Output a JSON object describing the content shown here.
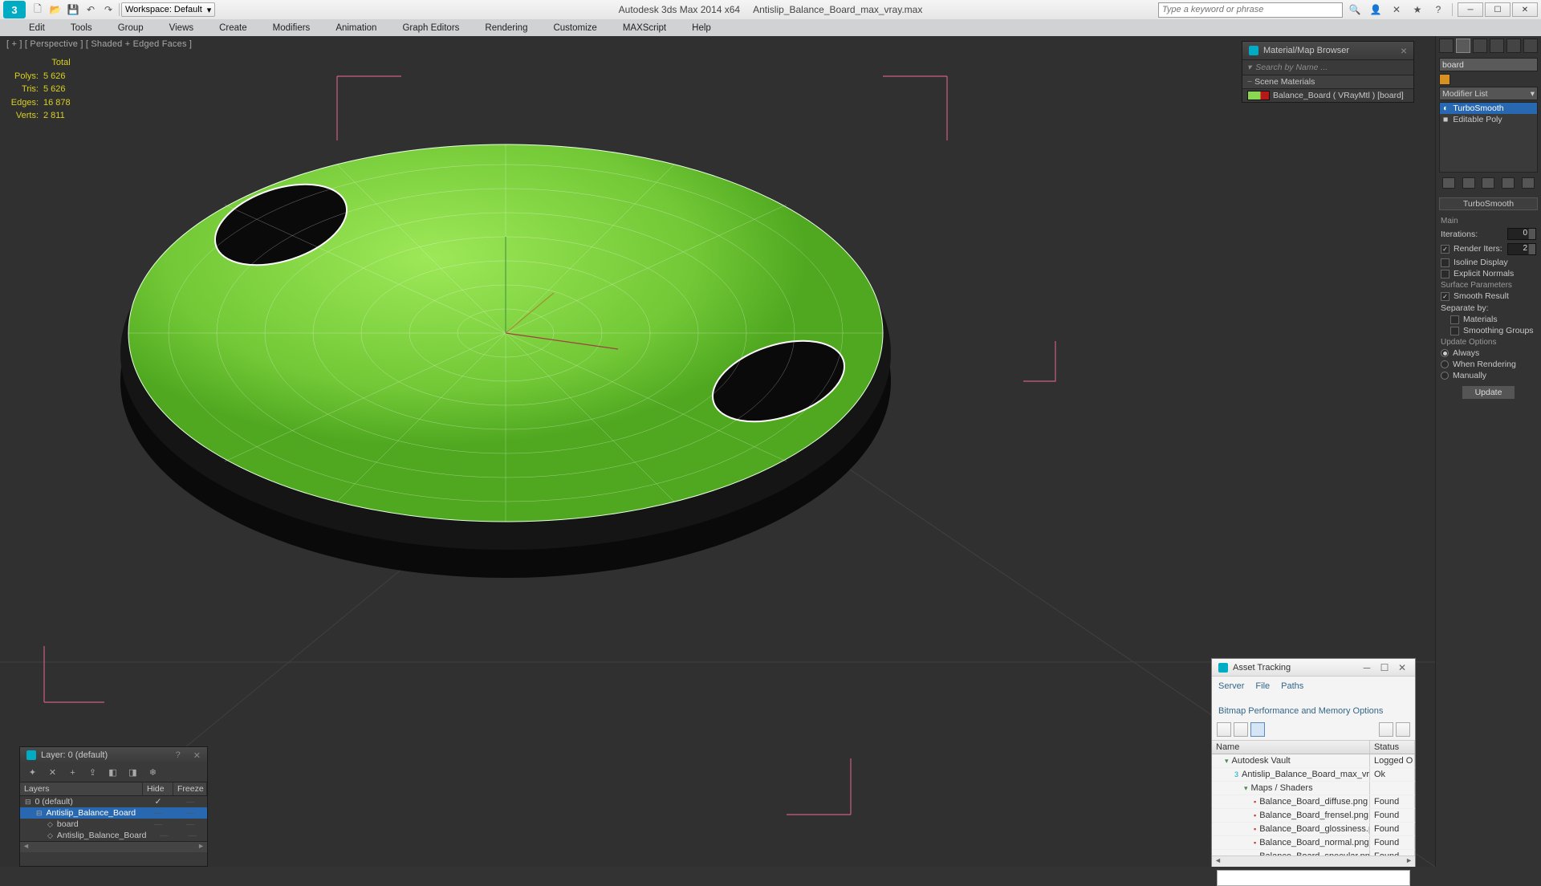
{
  "title": {
    "app": "Autodesk 3ds Max  2014 x64",
    "file": "Antislip_Balance_Board_max_vray.max"
  },
  "toolbar": {
    "workspace_label": "Workspace: Default",
    "search_placeholder": "Type a keyword or phrase"
  },
  "menus": [
    "Edit",
    "Tools",
    "Group",
    "Views",
    "Create",
    "Modifiers",
    "Animation",
    "Graph Editors",
    "Rendering",
    "Customize",
    "MAXScript",
    "Help"
  ],
  "viewport": {
    "label": "[ + ] [ Perspective ] [ Shaded + Edged Faces ]"
  },
  "stats": {
    "polys_label": "Polys:",
    "polys": "5 626",
    "tris_label": "Tris:",
    "tris": "5 626",
    "edges_label": "Edges:",
    "edges": "16 878",
    "verts_label": "Verts:",
    "verts": "2 811",
    "total": "Total"
  },
  "right_panel": {
    "object_name": "board",
    "modifier_list_label": "Modifier List",
    "stack": [
      {
        "icon": "◐",
        "name": "TurboSmooth"
      },
      {
        "icon": "■",
        "name": "Editable Poly"
      }
    ],
    "rollout": "TurboSmooth",
    "main_label": "Main",
    "iterations_label": "Iterations:",
    "iterations_val": "0",
    "render_iters_label": "Render Iters:",
    "render_iters_val": "2",
    "isoline_label": "Isoline Display",
    "explicit_label": "Explicit Normals",
    "surface_params_label": "Surface Parameters",
    "smooth_result_label": "Smooth Result",
    "separate_label": "Separate by:",
    "materials_label": "Materials",
    "smoothing_groups_label": "Smoothing Groups",
    "update_options_label": "Update Options",
    "always_label": "Always",
    "when_rendering_label": "When Rendering",
    "manually_label": "Manually",
    "update_btn": "Update"
  },
  "material_browser": {
    "title": "Material/Map Browser",
    "search": "Search by Name ...",
    "section": "Scene Materials",
    "item": "Balance_Board ( VRayMtl ) [board]"
  },
  "asset_tracking": {
    "title": "Asset Tracking",
    "menus": [
      "Server",
      "File",
      "Paths",
      "Bitmap Performance and Memory Options"
    ],
    "col_name": "Name",
    "col_status": "Status",
    "rows": [
      {
        "indent": 1,
        "icon": "▾",
        "name": "Autodesk Vault",
        "status": "Logged O"
      },
      {
        "indent": 2,
        "icon": "3",
        "name": "Antislip_Balance_Board_max_vray.max",
        "status": "Ok"
      },
      {
        "indent": 3,
        "icon": "▾",
        "name": "Maps / Shaders",
        "status": ""
      },
      {
        "indent": 4,
        "icon": "▪",
        "name": "Balance_Board_diffuse.png",
        "status": "Found"
      },
      {
        "indent": 4,
        "icon": "▪",
        "name": "Balance_Board_frensel.png",
        "status": "Found"
      },
      {
        "indent": 4,
        "icon": "▪",
        "name": "Balance_Board_glossiness.png",
        "status": "Found"
      },
      {
        "indent": 4,
        "icon": "▪",
        "name": "Balance_Board_normal.png",
        "status": "Found"
      },
      {
        "indent": 4,
        "icon": "▪",
        "name": "Balance_Board_specular.png",
        "status": "Found"
      }
    ]
  },
  "layer_window": {
    "title": "Layer: 0 (default)",
    "col_layers": "Layers",
    "col_hide": "Hide",
    "col_freeze": "Freeze",
    "rows": [
      {
        "indent": 0,
        "icon": "⊟",
        "name": "0 (default)",
        "sel": false,
        "check": true
      },
      {
        "indent": 1,
        "icon": "⊟",
        "name": "Antislip_Balance_Board",
        "sel": true
      },
      {
        "indent": 2,
        "icon": "◇",
        "name": "board",
        "sel": false
      },
      {
        "indent": 2,
        "icon": "◇",
        "name": "Antislip_Balance_Board",
        "sel": false
      }
    ]
  }
}
